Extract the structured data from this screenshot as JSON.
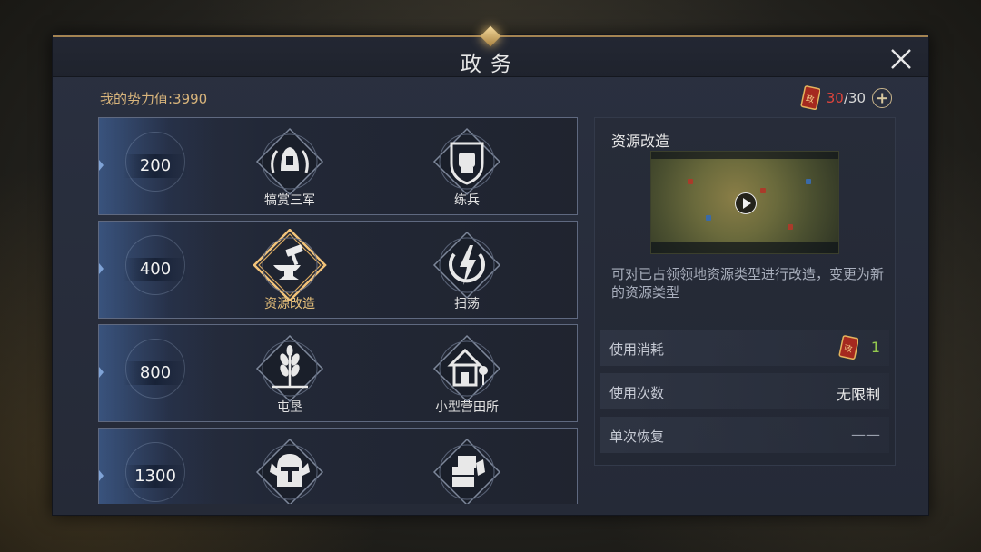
{
  "window": {
    "title": "政务"
  },
  "header": {
    "power_label": "我的势力值:3990",
    "orders_current": "30",
    "orders_max": "/30"
  },
  "tiers": [
    {
      "value": "200",
      "skills": [
        {
          "label": "犒赏三军",
          "icon": "helmet-laurel-icon"
        },
        {
          "label": "练兵",
          "icon": "fist-shield-icon"
        }
      ]
    },
    {
      "value": "400",
      "skills": [
        {
          "label": "资源改造",
          "icon": "anvil-hammer-icon"
        },
        {
          "label": "扫荡",
          "icon": "lightning-icon"
        }
      ]
    },
    {
      "value": "800",
      "skills": [
        {
          "label": "屯垦",
          "icon": "wheat-icon"
        },
        {
          "label": "小型营田所",
          "icon": "farmhouse-icon"
        }
      ]
    },
    {
      "value": "1300",
      "skills": [
        {
          "label": "",
          "icon": "knight-helmet-icon"
        },
        {
          "label": "",
          "icon": "crate-icon"
        }
      ]
    }
  ],
  "detail": {
    "title": "资源改造",
    "description": "可对已占领领地资源类型进行改造，变更为新的资源类型",
    "cost_label": "使用消耗",
    "cost_value": "1",
    "uses_label": "使用次数",
    "uses_value": "无限制",
    "recover_label": "单次恢复",
    "recover_value": "——"
  },
  "colors": {
    "accent_gold": "#e7c07a",
    "order_red": "#e0443c",
    "cost_green": "#93c94e"
  }
}
